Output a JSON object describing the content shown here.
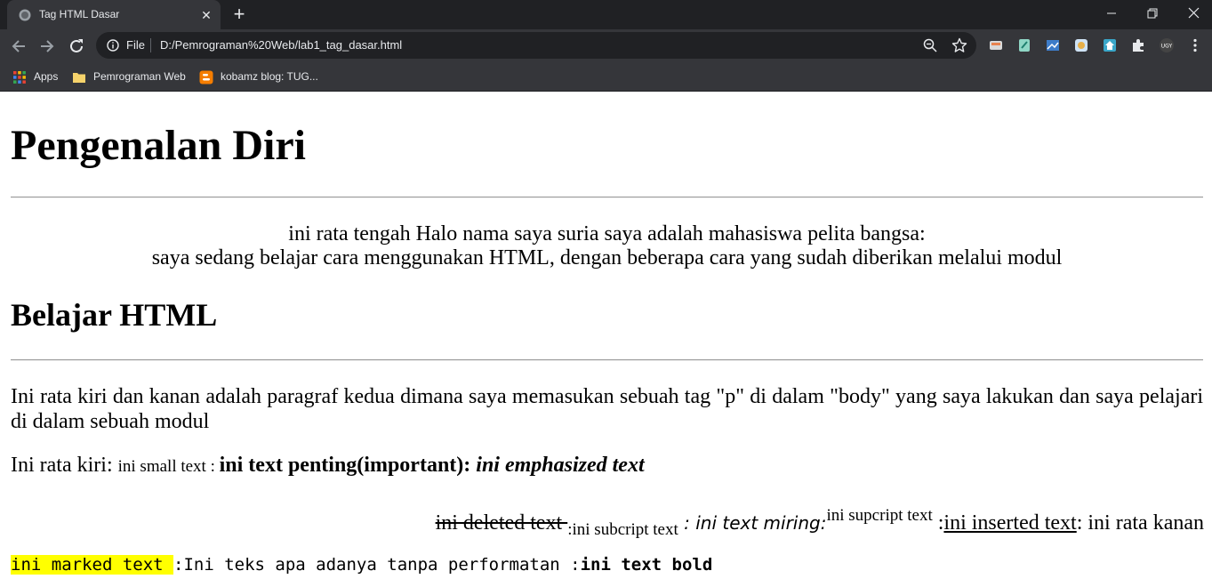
{
  "browser": {
    "tab": {
      "title": "Tag HTML Dasar",
      "close_icon": "close-icon"
    },
    "address_bar": {
      "scheme_label": "File",
      "url": "D:/Pemrograman%20Web/lab1_tag_dasar.html"
    },
    "bookmarks": [
      {
        "label": "Apps",
        "icon": "apps-grid-icon"
      },
      {
        "label": "Pemrograman Web",
        "icon": "folder-icon"
      },
      {
        "label": "kobamz blog: TUG...",
        "icon": "blogger-icon"
      }
    ],
    "accent_colors": {
      "chrome_dark": "#202124",
      "chrome_toolbar": "#35363a",
      "mark_highlight": "#ffff00"
    }
  },
  "page": {
    "heading1": "Pengenalan Diri",
    "center_paragraph": {
      "line1": "ini rata tengah Halo nama saya suria saya adalah mahasiswa pelita bangsa:",
      "line2": "saya sedang belajar cara menggunakan HTML, dengan beberapa cara yang sudah diberikan melalui modul"
    },
    "heading2": "Belajar HTML",
    "justify_paragraph": "Ini rata kiri dan kanan adalah paragraf kedua dimana saya memasukan sebuah tag \"p\" di dalam \"body\" yang saya lakukan dan saya pelajari di dalam sebuah modul",
    "left_paragraph": {
      "prefix": "Ini rata kiri: ",
      "small_text": "ini small text : ",
      "strong_text": "ini text penting(important): ",
      "em_text": "ini emphasized text"
    },
    "right_paragraph": {
      "deleted_text": "ini deleted text ",
      "subscript_text": ":ini subcript text",
      "italic_sep": " : ",
      "italic_text": "ini text miring:",
      "superscript_text": "ini supcript text",
      "sep_before_ins": " :",
      "inserted_text": "ini inserted text",
      "suffix": ": ini rata kanan"
    },
    "mono_paragraph": {
      "marked_text": "ini marked text ",
      "plain_text": ":Ini teks apa adanya tanpa performatan :",
      "bold_text": "ini text bold"
    }
  }
}
